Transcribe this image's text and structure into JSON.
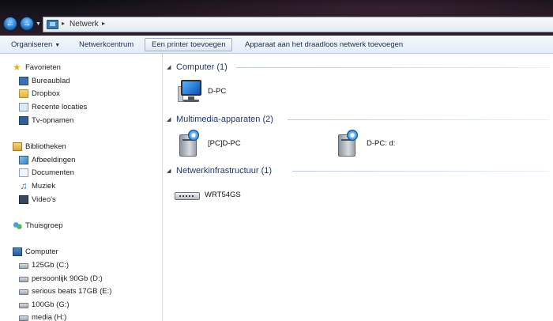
{
  "window": {
    "breadcrumb": [
      "Netwerk"
    ],
    "nav": {
      "back_icon": "back-arrow-icon",
      "forward_icon": "forward-arrow-icon"
    }
  },
  "toolbar": {
    "organize_label": "Organiseren",
    "network_center_label": "Netwerkcentrum",
    "add_printer_label": "Een printer toevoegen",
    "add_wireless_label": "Apparaat aan het draadloos netwerk toevoegen"
  },
  "sidebar": {
    "favorites": {
      "label": "Favorieten",
      "items": [
        {
          "label": "Bureaublad",
          "icon": "desktop-icon"
        },
        {
          "label": "Dropbox",
          "icon": "folder-icon"
        },
        {
          "label": "Recente locaties",
          "icon": "recent-places-icon"
        },
        {
          "label": "Tv-opnamen",
          "icon": "tv-icon"
        }
      ]
    },
    "libraries": {
      "label": "Bibliotheken",
      "items": [
        {
          "label": "Afbeeldingen",
          "icon": "pictures-icon"
        },
        {
          "label": "Documenten",
          "icon": "documents-icon"
        },
        {
          "label": "Muziek",
          "icon": "music-icon"
        },
        {
          "label": "Video's",
          "icon": "videos-icon"
        }
      ]
    },
    "homegroup": {
      "label": "Thuisgroep"
    },
    "computer": {
      "label": "Computer",
      "items": [
        {
          "label": "125Gb (C:)"
        },
        {
          "label": "persoonlijk 90Gb (D:)"
        },
        {
          "label": "serious beats 17GB (E:)"
        },
        {
          "label": "100Gb (G:)"
        },
        {
          "label": "media (H:)"
        }
      ]
    }
  },
  "main": {
    "groups": [
      {
        "title": "Computer (1)",
        "items": [
          {
            "label": "D-PC",
            "icon": "computer-icon"
          }
        ]
      },
      {
        "title": "Multimedia-apparaten (2)",
        "items": [
          {
            "label": "[PC]D-PC",
            "icon": "media-device-icon"
          },
          {
            "label": "D-PC: d:",
            "icon": "media-device-icon"
          }
        ]
      },
      {
        "title": "Netwerkinfrastructuur (1)",
        "items": [
          {
            "label": "WRT54GS",
            "icon": "router-icon"
          }
        ]
      }
    ]
  }
}
